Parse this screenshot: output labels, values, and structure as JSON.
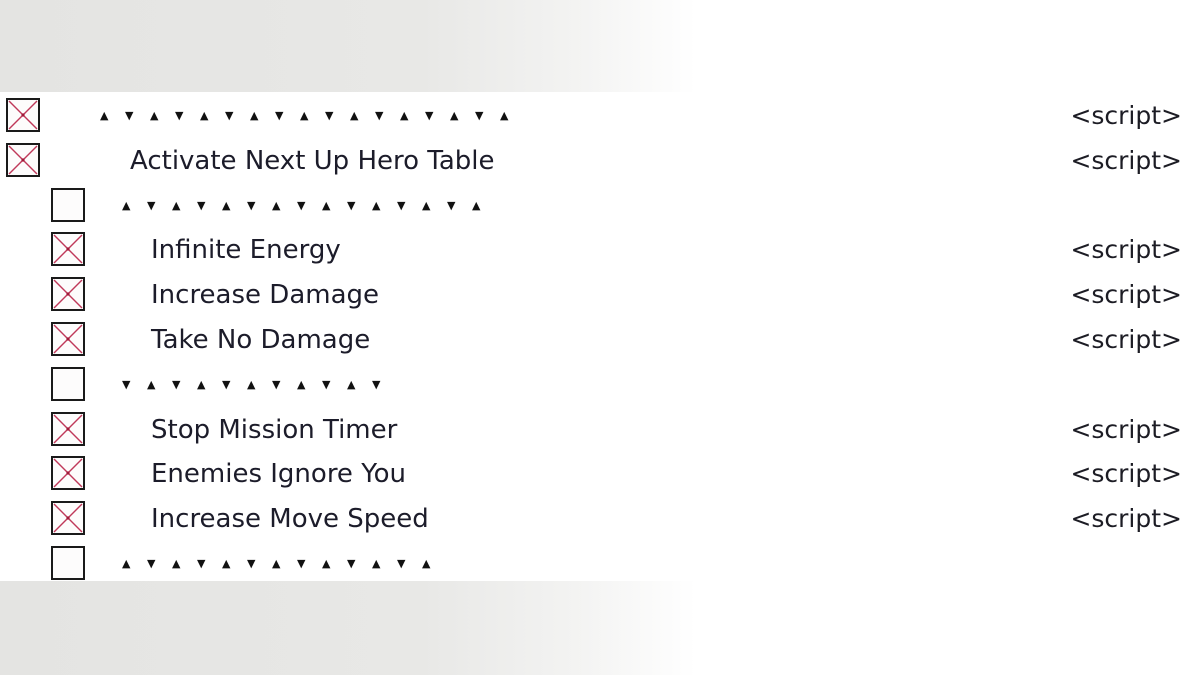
{
  "window": {
    "app": "Cheat Engine cheat table"
  },
  "colors": {
    "checkbox_border": "#1a1a1a",
    "checkbox_cross": "#c0395a",
    "text": "#1c1c2a",
    "background_shade": "#e6e6e4"
  },
  "icons": {
    "checked": "checkbox-checked-cross-icon",
    "unchecked": "checkbox-unchecked-icon",
    "up": "▲",
    "down": "▼"
  },
  "rows": [
    {
      "type": "separator",
      "level": 0,
      "checked": true,
      "pattern": "▲▼▲▼▲▼▲▼▲▼▲▼▲▼▲▼▲",
      "value": "<script>"
    },
    {
      "type": "entry",
      "level": 0,
      "checked": true,
      "description": "Activate Next Up Hero Table",
      "value": "<script>"
    },
    {
      "type": "separator",
      "level": 1,
      "checked": false,
      "pattern": "▲▼▲▼▲▼▲▼▲▼▲▼▲▼▲",
      "value": ""
    },
    {
      "type": "entry",
      "level": 1,
      "checked": true,
      "description": "Infinite Energy",
      "value": "<script>"
    },
    {
      "type": "entry",
      "level": 1,
      "checked": true,
      "description": "Increase Damage",
      "value": "<script>"
    },
    {
      "type": "entry",
      "level": 1,
      "checked": true,
      "description": "Take No Damage",
      "value": "<script>"
    },
    {
      "type": "separator",
      "level": 1,
      "checked": false,
      "pattern": "▼▲▼▲▼▲▼▲▼▲▼",
      "value": ""
    },
    {
      "type": "entry",
      "level": 1,
      "checked": true,
      "description": "Stop Mission Timer",
      "value": "<script>"
    },
    {
      "type": "entry",
      "level": 1,
      "checked": true,
      "description": "Enemies Ignore You",
      "value": "<script>"
    },
    {
      "type": "entry",
      "level": 1,
      "checked": true,
      "description": "Increase Move Speed",
      "value": "<script>"
    },
    {
      "type": "separator",
      "level": 1,
      "checked": false,
      "pattern": "▲▼▲▼▲▼▲▼▲▼▲▼▲",
      "value": ""
    }
  ]
}
